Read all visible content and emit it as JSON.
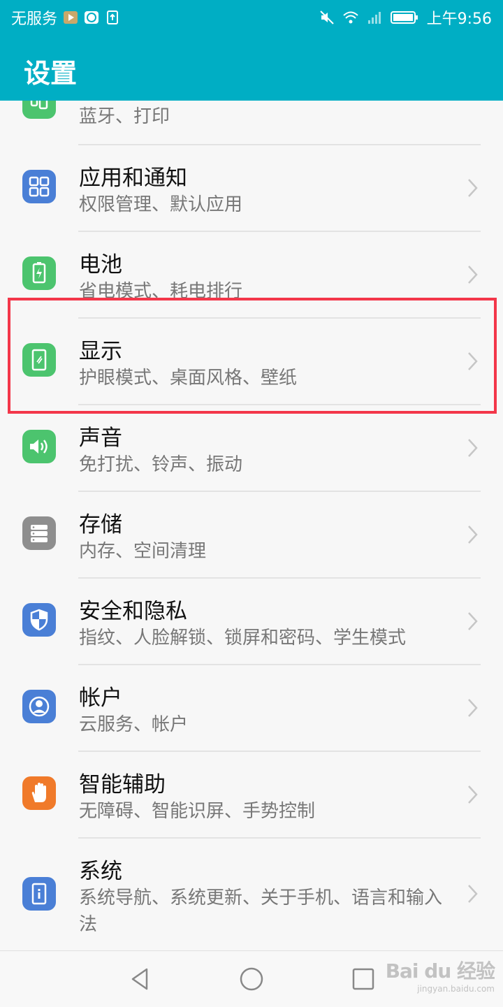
{
  "status_bar": {
    "carrier": "无服务",
    "time": "上午9:56"
  },
  "app_bar": {
    "title": "设置"
  },
  "settings": [
    {
      "title": "",
      "subtitle": "蓝牙、打印",
      "icon": "device-connection-icon",
      "color": "#4cc46e"
    },
    {
      "title": "应用和通知",
      "subtitle": "权限管理、默认应用",
      "icon": "apps-grid-icon",
      "color": "#4a7fd6"
    },
    {
      "title": "电池",
      "subtitle": "省电模式、耗电排行",
      "icon": "battery-icon",
      "color": "#4cc46e"
    },
    {
      "title": "显示",
      "subtitle": "护眼模式、桌面风格、壁纸",
      "icon": "display-icon",
      "color": "#4cc46e"
    },
    {
      "title": "声音",
      "subtitle": "免打扰、铃声、振动",
      "icon": "speaker-icon",
      "color": "#4cc46e"
    },
    {
      "title": "存储",
      "subtitle": "内存、空间清理",
      "icon": "storage-icon",
      "color": "#8e8e8e"
    },
    {
      "title": "安全和隐私",
      "subtitle": "指纹、人脸解锁、锁屏和密码、学生模式",
      "icon": "shield-icon",
      "color": "#4a7fd6"
    },
    {
      "title": "帐户",
      "subtitle": "云服务、帐户",
      "icon": "account-icon",
      "color": "#4a7fd6"
    },
    {
      "title": "智能辅助",
      "subtitle": "无障碍、智能识屏、手势控制",
      "icon": "hand-icon",
      "color": "#f07a2a"
    },
    {
      "title": "系统",
      "subtitle": "系统导航、系统更新、关于手机、语言和输入法",
      "icon": "system-info-icon",
      "color": "#4a7fd6"
    }
  ],
  "highlight_color": "#f3374a",
  "watermark": {
    "main": "Bai du 经验",
    "sub": "jingyan.baidu.com"
  }
}
